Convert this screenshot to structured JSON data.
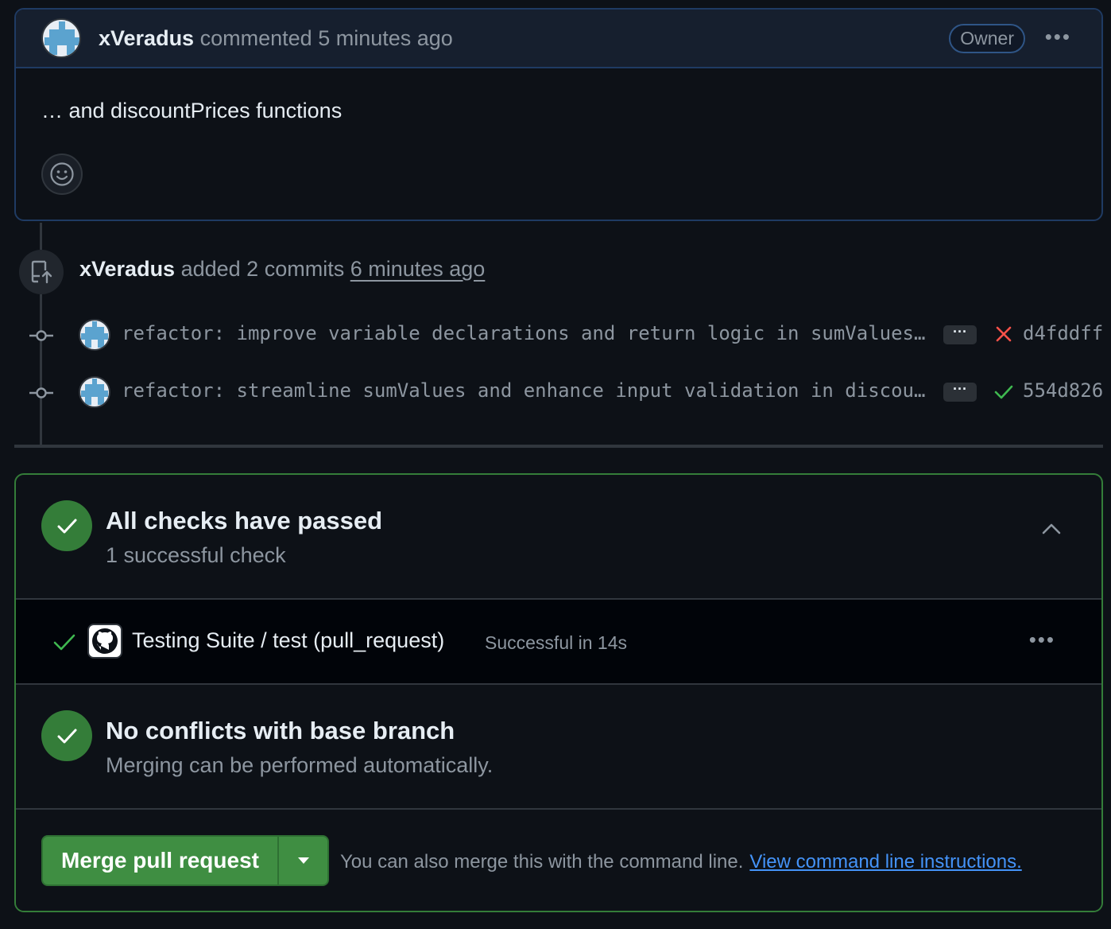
{
  "comment": {
    "author": "xVeradus",
    "action": "commented",
    "time": "5 minutes ago",
    "badge": "Owner",
    "body": "… and discountPrices functions"
  },
  "push_event": {
    "author": "xVeradus",
    "action": "added 2 commits",
    "time": "6 minutes ago"
  },
  "commits": [
    {
      "message": "refactor: improve variable declarations and return logic in sumValues…",
      "ellipsis": "···",
      "status": "failed",
      "sha": "d4fddff"
    },
    {
      "message": "refactor: streamline sumValues and enhance input validation in discou…",
      "ellipsis": "···",
      "status": "success",
      "sha": "554d826"
    }
  ],
  "checks": {
    "title": "All checks have passed",
    "subtitle": "1 successful check",
    "run": {
      "name": "Testing Suite / test (pull_request)",
      "status": "Successful in 14s"
    }
  },
  "conflicts": {
    "title": "No conflicts with base branch",
    "subtitle": "Merging can be performed automatically."
  },
  "merge": {
    "button_label": "Merge pull request",
    "hint": "You can also merge this with the command line.",
    "link": "View command line instructions."
  },
  "colors": {
    "success": "#347d39",
    "danger": "#f85149",
    "link": "#4493f8",
    "owner_border": "#2f5586"
  }
}
